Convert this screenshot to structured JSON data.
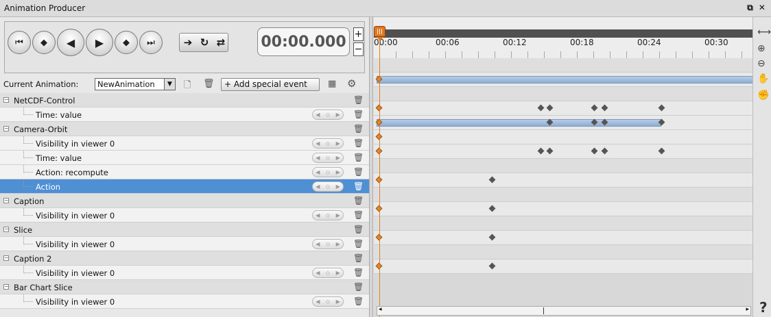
{
  "window": {
    "title": "Animation Producer",
    "controls": "⧉ ✕"
  },
  "player": {
    "time": "00:00.000",
    "plus": "+",
    "minus": "−"
  },
  "toolbar": {
    "current_animation_label": "Current Animation:",
    "animation_name": "NewAnimation",
    "add_event_label": "+ Add special event"
  },
  "tracks": [
    {
      "label": "NetCDF-Control",
      "type": "group"
    },
    {
      "label": "Time: value",
      "type": "child"
    },
    {
      "label": "Camera-Orbit",
      "type": "group"
    },
    {
      "label": "Visibility in viewer 0",
      "type": "child"
    },
    {
      "label": "Time: value",
      "type": "child"
    },
    {
      "label": "Action: recompute",
      "type": "child"
    },
    {
      "label": "Action",
      "type": "child",
      "selected": true
    },
    {
      "label": "Caption",
      "type": "group"
    },
    {
      "label": "Visibility in viewer 0",
      "type": "child"
    },
    {
      "label": "Slice",
      "type": "group"
    },
    {
      "label": "Visibility in viewer 0",
      "type": "child"
    },
    {
      "label": "Caption 2",
      "type": "group"
    },
    {
      "label": "Visibility in viewer 0",
      "type": "child"
    },
    {
      "label": "Bar Chart Slice",
      "type": "group"
    },
    {
      "label": "Visibility in viewer 0",
      "type": "child"
    }
  ],
  "timeline": {
    "ticks": [
      "00:00",
      "00:06",
      "00:12",
      "00:18",
      "00:24",
      "00:30"
    ]
  },
  "help_label": "?"
}
